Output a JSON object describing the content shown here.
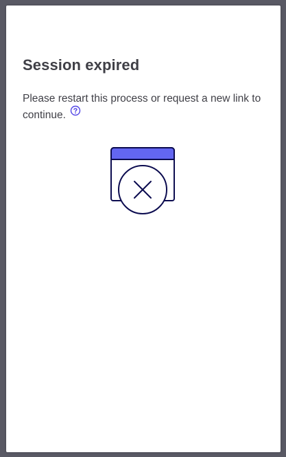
{
  "dialog": {
    "title": "Session expired",
    "message": "Please restart this process or request a new link to continue."
  },
  "icons": {
    "help": "question-circle-icon",
    "illustration": "expired-window-x-icon"
  },
  "colors": {
    "backdrop": "#595964",
    "card": "#ffffff",
    "text": "#3f3f46",
    "accent": "#6366f1",
    "outline": "#0b0b4f"
  }
}
